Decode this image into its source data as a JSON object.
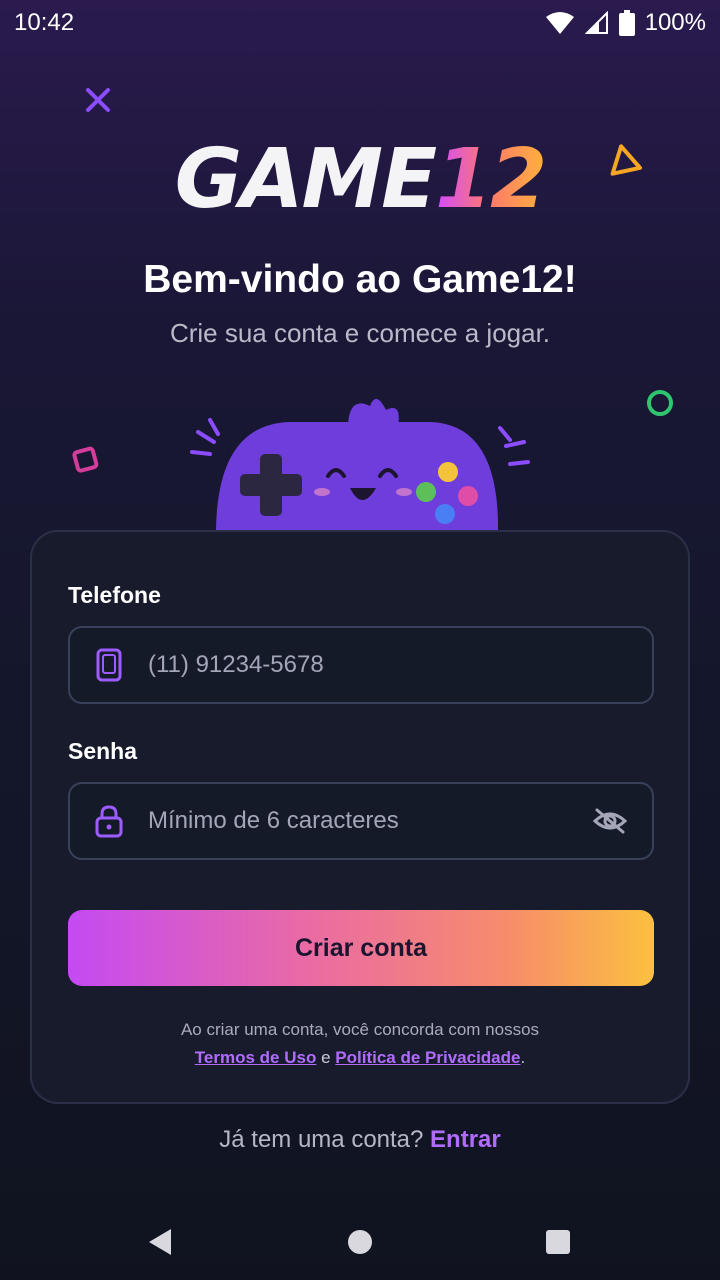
{
  "status_bar": {
    "time": "10:42",
    "battery": "100%"
  },
  "brand": {
    "logo_text": "GAME",
    "logo_number": "12"
  },
  "welcome": {
    "title": "Bem-vindo ao Game12!",
    "subtitle": "Crie sua conta e comece a jogar."
  },
  "form": {
    "phone": {
      "label": "Telefone",
      "placeholder": "(11) 91234-5678",
      "value": ""
    },
    "password": {
      "label": "Senha",
      "placeholder": "Mínimo de 6 caracteres",
      "value": ""
    },
    "submit_label": "Criar conta"
  },
  "terms": {
    "prefix": "Ao criar uma conta, você concorda com nossos",
    "terms_link": "Termos de Uso",
    "conjunction": "e",
    "privacy_link": "Política de Privacidade",
    "suffix": "."
  },
  "login_prompt": {
    "text": "Já tem uma conta?",
    "link": "Entrar"
  },
  "colors": {
    "accent": "#b06cff",
    "gradient_start": "#c44af3",
    "gradient_end": "#fbc03f",
    "card_bg": "#171b2b"
  },
  "icons": {
    "close": "close-icon",
    "phone": "phone-icon",
    "lock": "lock-icon",
    "eye_off": "eye-off-icon",
    "back": "back-nav-icon",
    "home": "home-nav-icon",
    "recents": "recents-nav-icon"
  }
}
